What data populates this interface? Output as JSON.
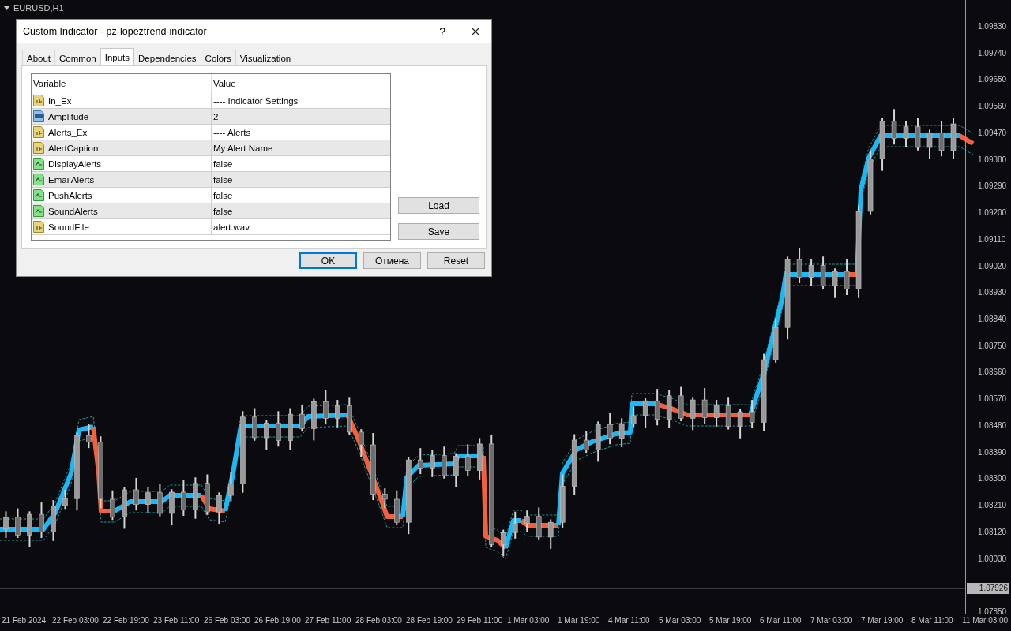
{
  "chart": {
    "symbol": "EURUSD,H1",
    "current_price": "1.07926",
    "time_labels": [
      "21 Feb 2024",
      "22 Feb 03:00",
      "22 Feb 19:00",
      "23 Feb 11:00",
      "26 Feb 03:00",
      "26 Feb 19:00",
      "27 Feb 11:00",
      "28 Feb 03:00",
      "28 Feb 19:00",
      "29 Feb 11:00",
      "1 Mar 03:00",
      "1 Mar 19:00",
      "4 Mar 11:00",
      "5 Mar 03:00",
      "5 Mar 19:00",
      "6 Mar 11:00",
      "7 Mar 03:00",
      "7 Mar 19:00",
      "8 Mar 11:00",
      "11 Mar 03:00"
    ],
    "chart_data": {
      "type": "candlestick",
      "ylim": [
        1.07842,
        1.09918
      ],
      "yticks": [
        {
          "value": 1.0983,
          "label": "1.09830"
        },
        {
          "value": 1.0974,
          "label": "1.09740"
        },
        {
          "value": 1.0965,
          "label": "1.09650"
        },
        {
          "value": 1.0956,
          "label": "1.09560"
        },
        {
          "value": 1.0947,
          "label": "1.09470"
        },
        {
          "value": 1.0938,
          "label": "1.09380"
        },
        {
          "value": 1.0929,
          "label": "1.09290"
        },
        {
          "value": 1.092,
          "label": "1.09200"
        },
        {
          "value": 1.0911,
          "label": "1.09110"
        },
        {
          "value": 1.0902,
          "label": "1.09020"
        },
        {
          "value": 1.0893,
          "label": "1.08930"
        },
        {
          "value": 1.0884,
          "label": "1.08840"
        },
        {
          "value": 1.0875,
          "label": "1.08750"
        },
        {
          "value": 1.0866,
          "label": "1.08660"
        },
        {
          "value": 1.0857,
          "label": "1.08570"
        },
        {
          "value": 1.0848,
          "label": "1.08480"
        },
        {
          "value": 1.0839,
          "label": "1.08390"
        },
        {
          "value": 1.083,
          "label": "1.08300"
        },
        {
          "value": 1.0821,
          "label": "1.08210"
        },
        {
          "value": 1.0812,
          "label": "1.08120"
        },
        {
          "value": 1.0803,
          "label": "1.08030"
        },
        {
          "value": 1.0785,
          "label": "1.07850"
        }
      ],
      "categories": [
        null,
        null,
        null,
        null,
        null,
        null,
        null,
        null,
        null,
        null,
        null,
        null,
        null,
        null,
        null,
        null,
        null,
        null,
        null,
        null,
        null,
        null,
        null,
        null,
        null,
        null,
        null,
        null,
        null,
        null,
        null,
        null,
        null,
        null,
        null,
        null,
        null,
        null,
        null,
        null,
        null,
        null,
        null,
        null,
        null,
        null,
        null,
        null,
        null,
        null,
        null,
        null,
        null,
        null,
        null,
        null,
        null,
        null,
        null,
        null,
        null,
        null,
        null,
        null,
        null,
        null,
        null,
        null,
        null,
        null,
        null,
        null,
        null,
        null,
        null,
        null,
        null,
        null,
        null,
        null,
        null
      ],
      "ohlc": [
        [
          1.08128,
          1.08188,
          1.08098,
          1.08168
        ],
        [
          1.08168,
          1.08198,
          1.08098,
          1.08108
        ],
        [
          1.08108,
          1.08188,
          1.08068,
          1.08178
        ],
        [
          1.08178,
          1.08218,
          1.08098,
          1.08118
        ],
        [
          1.08118,
          1.08226,
          1.08088,
          1.08206
        ],
        [
          1.08206,
          1.08261,
          1.08196,
          1.08231
        ],
        [
          1.08231,
          1.08455,
          1.08191,
          1.08445
        ],
        [
          1.08445,
          1.08485,
          1.08402,
          1.08422
        ],
        [
          1.08422,
          1.08442,
          1.08199,
          1.08229
        ],
        [
          1.08229,
          1.08259,
          1.08159,
          1.08169
        ],
        [
          1.08169,
          1.08271,
          1.08129,
          1.08261
        ],
        [
          1.08261,
          1.08301,
          1.08191,
          1.08211
        ],
        [
          1.08211,
          1.08271,
          1.08181,
          1.08251
        ],
        [
          1.08251,
          1.08281,
          1.08171,
          1.08181
        ],
        [
          1.08181,
          1.08263,
          1.08141,
          1.08253
        ],
        [
          1.08253,
          1.08293,
          1.08173,
          1.08193
        ],
        [
          1.08193,
          1.08303,
          1.08163,
          1.08283
        ],
        [
          1.08283,
          1.08313,
          1.08176,
          1.08186
        ],
        [
          1.08186,
          1.08252,
          1.08146,
          1.08242
        ],
        [
          1.08242,
          1.08321,
          1.08222,
          1.08281
        ],
        [
          1.08281,
          1.08527,
          1.08251,
          1.08507
        ],
        [
          1.08507,
          1.08537,
          1.08427,
          1.08437
        ],
        [
          1.08437,
          1.08497,
          1.08397,
          1.08487
        ],
        [
          1.08487,
          1.08527,
          1.08407,
          1.08427
        ],
        [
          1.08427,
          1.08537,
          1.08397,
          1.08517
        ],
        [
          1.08517,
          1.08547,
          1.08458,
          1.08468
        ],
        [
          1.08468,
          1.08569,
          1.08428,
          1.08559
        ],
        [
          1.08559,
          1.08599,
          1.08482,
          1.08502
        ],
        [
          1.08502,
          1.08565,
          1.08472,
          1.08545
        ],
        [
          1.08545,
          1.08575,
          1.08446,
          1.08456
        ],
        [
          1.08456,
          1.08466,
          1.08373,
          1.08413
        ],
        [
          1.08413,
          1.08453,
          1.08226,
          1.08246
        ],
        [
          1.08246,
          1.08266,
          1.08199,
          1.08229
        ],
        [
          1.08229,
          1.08259,
          1.08141,
          1.08151
        ],
        [
          1.08151,
          1.08372,
          1.08111,
          1.08362
        ],
        [
          1.08362,
          1.08402,
          1.08314,
          1.08334
        ],
        [
          1.08334,
          1.08397,
          1.08304,
          1.08377
        ],
        [
          1.08377,
          1.08407,
          1.08299,
          1.08309
        ],
        [
          1.08309,
          1.08385,
          1.08269,
          1.08375
        ],
        [
          1.08375,
          1.08415,
          1.08306,
          1.08326
        ],
        [
          1.08326,
          1.08436,
          1.08296,
          1.08416
        ],
        [
          1.08416,
          1.08446,
          1.08066,
          1.08076
        ],
        [
          1.08076,
          1.08126,
          1.08036,
          1.08116
        ],
        [
          1.08116,
          1.08187,
          1.08096,
          1.08147
        ],
        [
          1.08147,
          1.08191,
          1.08117,
          1.08171
        ],
        [
          1.08171,
          1.08201,
          1.08091,
          1.08101
        ],
        [
          1.08101,
          1.08161,
          1.08061,
          1.08151
        ],
        [
          1.08151,
          1.08313,
          1.08131,
          1.08273
        ],
        [
          1.08273,
          1.08449,
          1.08243,
          1.08429
        ],
        [
          1.08429,
          1.08459,
          1.08386,
          1.08396
        ],
        [
          1.08396,
          1.08492,
          1.08356,
          1.08482
        ],
        [
          1.08482,
          1.08522,
          1.08415,
          1.08435
        ],
        [
          1.08435,
          1.08503,
          1.08405,
          1.08483
        ],
        [
          1.08483,
          1.08542,
          1.08473,
          1.08512
        ],
        [
          1.08512,
          1.08572,
          1.08472,
          1.08562
        ],
        [
          1.08562,
          1.08602,
          1.08479,
          1.08499
        ],
        [
          1.08499,
          1.08599,
          1.08469,
          1.08579
        ],
        [
          1.08579,
          1.08609,
          1.08493,
          1.08503
        ],
        [
          1.08503,
          1.08575,
          1.08463,
          1.08565
        ],
        [
          1.08565,
          1.08605,
          1.08485,
          1.08505
        ],
        [
          1.08505,
          1.08565,
          1.08475,
          1.08545
        ],
        [
          1.08545,
          1.08575,
          1.08465,
          1.08475
        ],
        [
          1.08475,
          1.08535,
          1.08435,
          1.08525
        ],
        [
          1.08525,
          1.08565,
          1.08469,
          1.08489
        ],
        [
          1.08489,
          1.08721,
          1.08459,
          1.08701
        ],
        [
          1.08701,
          1.0884,
          1.08691,
          1.0881
        ],
        [
          1.0881,
          1.0905,
          1.0877,
          1.0904
        ],
        [
          1.0904,
          1.0908,
          1.0896,
          1.0898
        ],
        [
          1.0898,
          1.0904,
          1.0895,
          1.0902
        ],
        [
          1.0902,
          1.0905,
          1.0894,
          1.0895
        ],
        [
          1.0895,
          1.0901,
          1.0891,
          1.09
        ],
        [
          1.09,
          1.0904,
          1.0892,
          1.0894
        ],
        [
          1.0894,
          1.09223,
          1.0891,
          1.09203
        ],
        [
          1.09203,
          1.0941,
          1.09193,
          1.0938
        ],
        [
          1.0938,
          1.09519,
          1.0934,
          1.09509
        ],
        [
          1.09509,
          1.09549,
          1.09429,
          1.09449
        ],
        [
          1.09449,
          1.09509,
          1.09419,
          1.09489
        ],
        [
          1.09489,
          1.09519,
          1.09409,
          1.09419
        ],
        [
          1.09419,
          1.09479,
          1.09379,
          1.09469
        ],
        [
          1.09469,
          1.09509,
          1.09389,
          1.09409
        ],
        [
          1.09409,
          1.09519,
          1.09379,
          1.09499
        ]
      ]
    }
  },
  "dialog": {
    "title": "Custom Indicator - pz-lopeztrend-indicator",
    "help": "?",
    "tabs": [
      {
        "label": "About",
        "selected": false
      },
      {
        "label": "Common",
        "selected": false
      },
      {
        "label": "Inputs",
        "selected": true
      },
      {
        "label": "Dependencies",
        "selected": false
      },
      {
        "label": "Colors",
        "selected": false
      },
      {
        "label": "Visualization",
        "selected": false
      }
    ],
    "table": {
      "columns": [
        "Variable",
        "Value"
      ],
      "rows": [
        {
          "kind": "string",
          "variable": "In_Ex",
          "value": "---- Indicator Settings"
        },
        {
          "kind": "int",
          "variable": "Amplitude",
          "value": "2"
        },
        {
          "kind": "string",
          "variable": "Alerts_Ex",
          "value": "---- Alerts"
        },
        {
          "kind": "string",
          "variable": "AlertCaption",
          "value": "My Alert Name"
        },
        {
          "kind": "bool",
          "variable": "DisplayAlerts",
          "value": "false"
        },
        {
          "kind": "bool",
          "variable": "EmailAlerts",
          "value": "false"
        },
        {
          "kind": "bool",
          "variable": "PushAlerts",
          "value": "false"
        },
        {
          "kind": "bool",
          "variable": "SoundAlerts",
          "value": "false"
        },
        {
          "kind": "string",
          "variable": "SoundFile",
          "value": "alert.wav"
        }
      ]
    },
    "side_buttons": [
      "Load",
      "Save"
    ],
    "buttons": [
      {
        "label": "OK",
        "default": true
      },
      {
        "label": "Отмена",
        "default": false
      },
      {
        "label": "Reset",
        "default": false
      }
    ]
  }
}
